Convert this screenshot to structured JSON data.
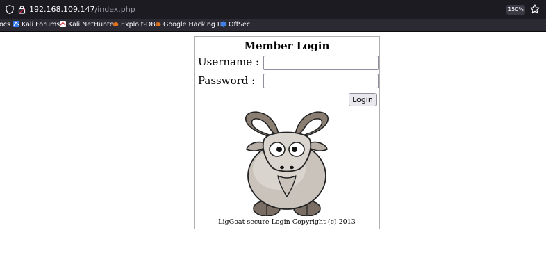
{
  "browser": {
    "url_host": "192.168.109.147",
    "url_path": "/index.php",
    "zoom": "150%"
  },
  "bookmarks": [
    {
      "label": "ocs",
      "icon": "docs-icon"
    },
    {
      "label": "Kali Forums",
      "icon": "kali-forums-icon"
    },
    {
      "label": "Kali NetHunter",
      "icon": "kali-nethunter-icon"
    },
    {
      "label": "Exploit-DB",
      "icon": "exploit-db-icon"
    },
    {
      "label": "Google Hacking DB",
      "icon": "google-hacking-db-icon"
    },
    {
      "label": "OffSec",
      "icon": "offsec-icon"
    }
  ],
  "login": {
    "title": "Member Login",
    "username_label": "Username  :",
    "password_label": "Password   :",
    "username_value": "",
    "password_value": "",
    "button_label": "Login",
    "footer": "LigGoat secure Login Copyright (c) 2013"
  },
  "colors": {
    "toolbar_bg": "#1c1b22",
    "bookmarks_bg": "#2b2a33",
    "goat_body": "#c9c3bb",
    "goat_horn": "#8a7d72"
  }
}
